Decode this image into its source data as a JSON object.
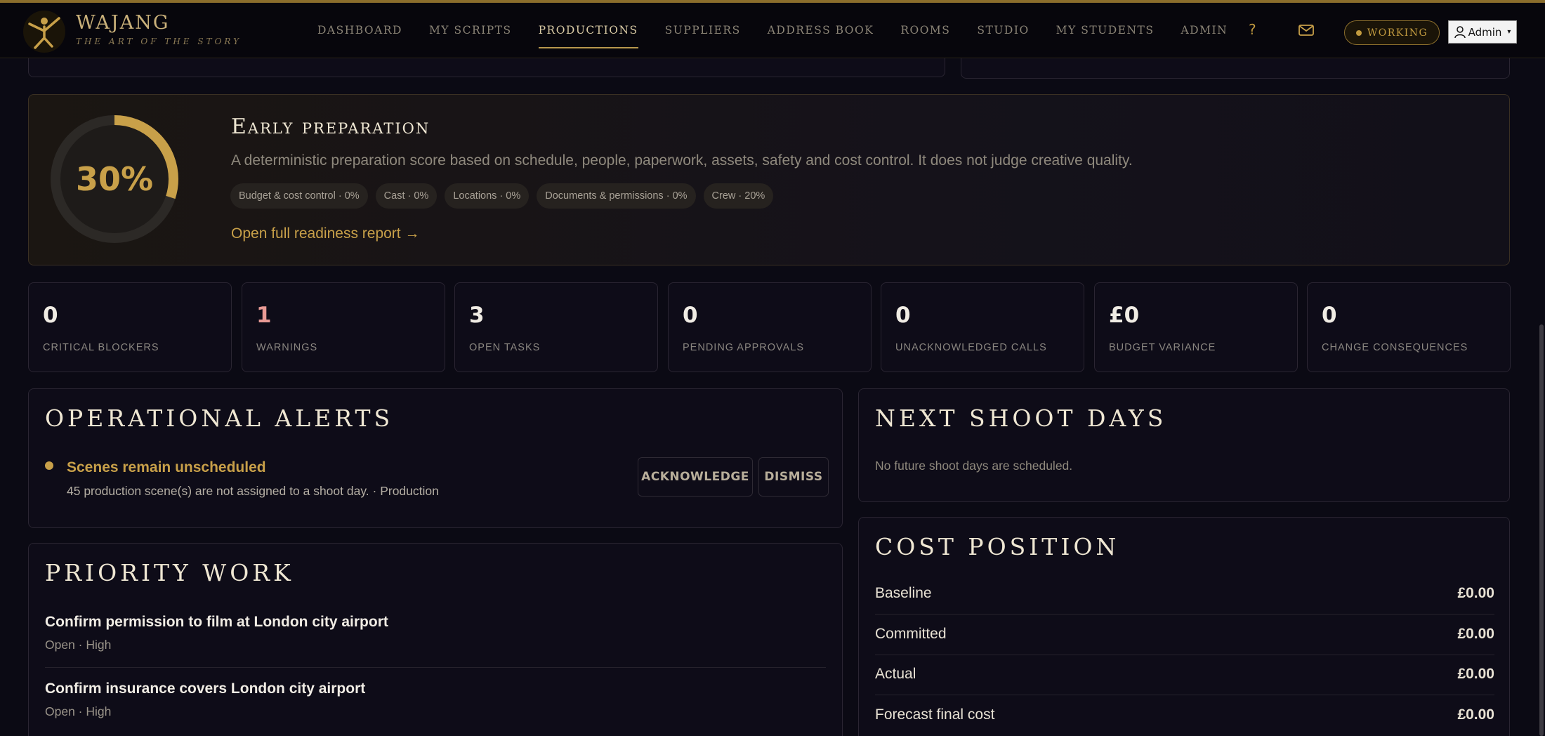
{
  "brand": {
    "name": "WAJANG",
    "tagline": "THE ART OF THE STORY"
  },
  "nav": {
    "items": [
      {
        "label": "DASHBOARD",
        "active": false
      },
      {
        "label": "MY SCRIPTS",
        "active": false
      },
      {
        "label": "PRODUCTIONS",
        "active": true
      },
      {
        "label": "SUPPLIERS",
        "active": false
      },
      {
        "label": "ADDRESS BOOK",
        "active": false
      },
      {
        "label": "ROOMS",
        "active": false
      },
      {
        "label": "STUDIO",
        "active": false
      },
      {
        "label": "MY STUDENTS",
        "active": false
      },
      {
        "label": "ADMIN",
        "active": false
      }
    ],
    "help_label": "?",
    "status_label": "WORKING",
    "user_label": "Admin",
    "user_caret": "▾"
  },
  "readiness": {
    "percent_label": "30%",
    "percent": 0.3,
    "title": "Early preparation",
    "description": "A deterministic preparation score based on schedule, people, paperwork, assets, safety and cost control. It does not judge creative quality.",
    "chips": [
      "Budget & cost control · 0%",
      "Cast · 0%",
      "Locations · 0%",
      "Documents & permissions · 0%",
      "Crew · 20%"
    ],
    "link_label": "Open full readiness report →"
  },
  "stats": [
    {
      "value": "0",
      "label": "CRITICAL BLOCKERS",
      "warn": false
    },
    {
      "value": "1",
      "label": "WARNINGS",
      "warn": true
    },
    {
      "value": "3",
      "label": "OPEN TASKS",
      "warn": false
    },
    {
      "value": "0",
      "label": "PENDING APPROVALS",
      "warn": false
    },
    {
      "value": "0",
      "label": "UNACKNOWLEDGED CALLS",
      "warn": false
    },
    {
      "value": "£0",
      "label": "BUDGET VARIANCE",
      "warn": false
    },
    {
      "value": "0",
      "label": "CHANGE CONSEQUENCES",
      "warn": false
    }
  ],
  "alerts": {
    "title": "OPERATIONAL ALERTS",
    "item": {
      "title": "Scenes remain unscheduled",
      "description": "45 production scene(s) are not assigned to a shoot day. · Production"
    },
    "acknowledge_label": "ACKNOWLEDGE",
    "dismiss_label": "DISMISS"
  },
  "shoot_days": {
    "title": "NEXT SHOOT DAYS",
    "empty_text": "No future shoot days are scheduled."
  },
  "priority": {
    "title": "PRIORITY WORK",
    "tasks": [
      {
        "title": "Confirm permission to film at London city airport",
        "meta": "Open · High"
      },
      {
        "title": "Confirm insurance covers London city airport",
        "meta": "Open · High"
      }
    ]
  },
  "cost": {
    "title": "COST POSITION",
    "rows": [
      {
        "label": "Baseline",
        "amount": "£0.00"
      },
      {
        "label": "Committed",
        "amount": "£0.00"
      },
      {
        "label": "Actual",
        "amount": "£0.00"
      },
      {
        "label": "Forecast final cost",
        "amount": "£0.00"
      }
    ]
  },
  "colors": {
    "gold": "#c8a049",
    "warning": "#e89a95",
    "background": "#0b0a14"
  }
}
